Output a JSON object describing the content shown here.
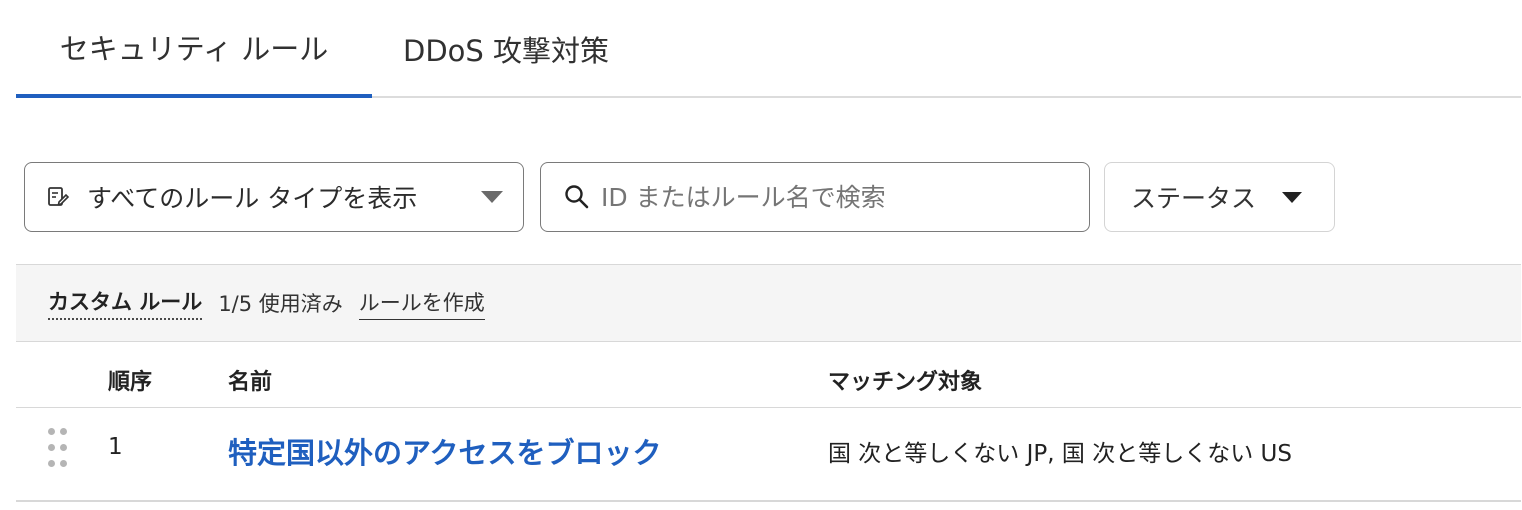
{
  "tabs": [
    {
      "label": "セキュリティ ルール",
      "active": true
    },
    {
      "label": "DDoS 攻撃対策",
      "active": false
    }
  ],
  "filters": {
    "rule_type_label": "すべてのルール タイプを表示",
    "search_placeholder": "ID またはルール名で検索",
    "status_label": "ステータス"
  },
  "custom_rules": {
    "title": "カスタム ルール",
    "usage": "1/5 使用済み",
    "create_link": "ルールを作成"
  },
  "table": {
    "headers": {
      "order": "順序",
      "name": "名前",
      "match": "マッチング対象"
    },
    "rows": [
      {
        "order": "1",
        "name": "特定国以外のアクセスをブロック",
        "match": "国 次と等しくない JP, 国 次と等しくない US"
      }
    ]
  },
  "colors": {
    "accent": "#1f5fbf",
    "border": "#d8d8d8",
    "bar_bg": "#f5f5f5"
  },
  "icons": {
    "rule_type": "edit-list-icon",
    "search": "search-icon",
    "drag": "drag-handle-icon"
  }
}
